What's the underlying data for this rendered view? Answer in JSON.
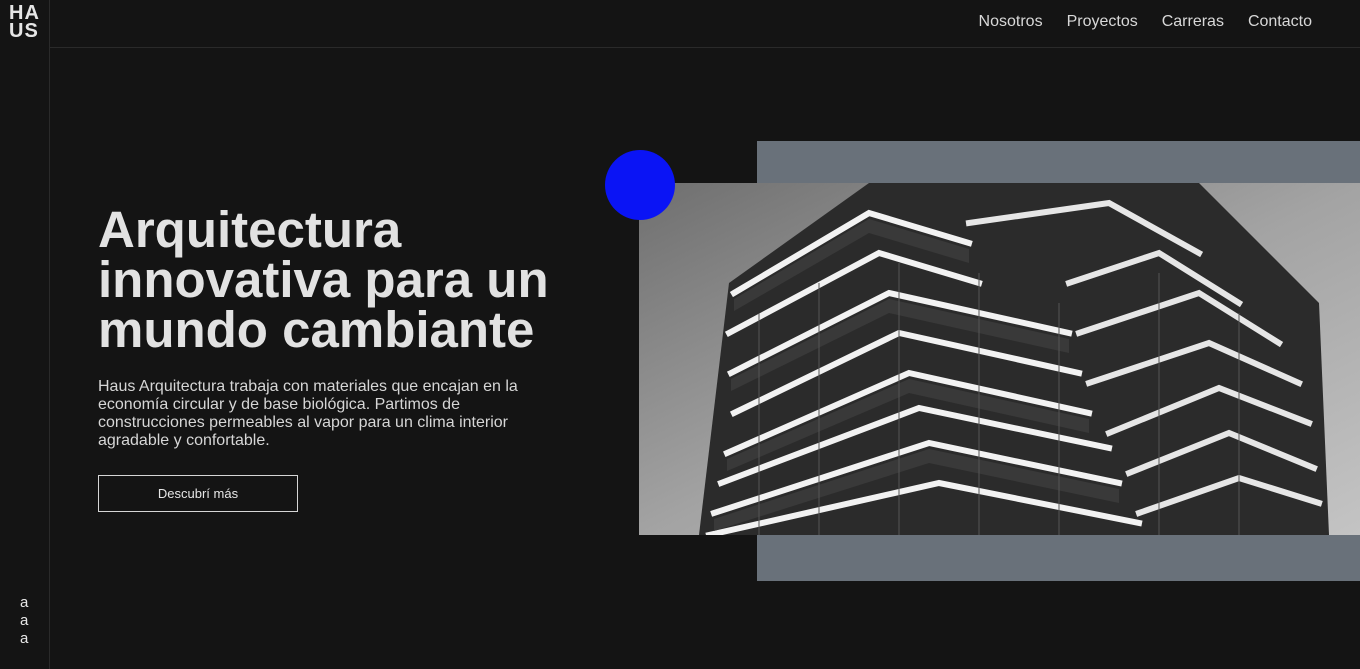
{
  "brand": {
    "logo_line1": "HA",
    "logo_line2": "US"
  },
  "nav": {
    "items": [
      "Nosotros",
      "Proyectos",
      "Carreras",
      "Contacto"
    ]
  },
  "hero": {
    "title": "Arquitectura innovativa para un mundo cambiante",
    "text": "Haus Arquitectura trabaja con materiales que encajan en la economía circular y de base biológica. Partimos de construcciones permeables al vapor para un clima interior agradable y confortable.",
    "cta_label": "Descubrí más"
  },
  "rail_links": [
    "a",
    "a",
    "a"
  ],
  "image": {
    "subject": "building-photo",
    "style": "black-and-white"
  },
  "colors": {
    "background": "#141414",
    "accent": "#0a14f5",
    "panel": "#69717a",
    "text": "#e6e6e6"
  }
}
